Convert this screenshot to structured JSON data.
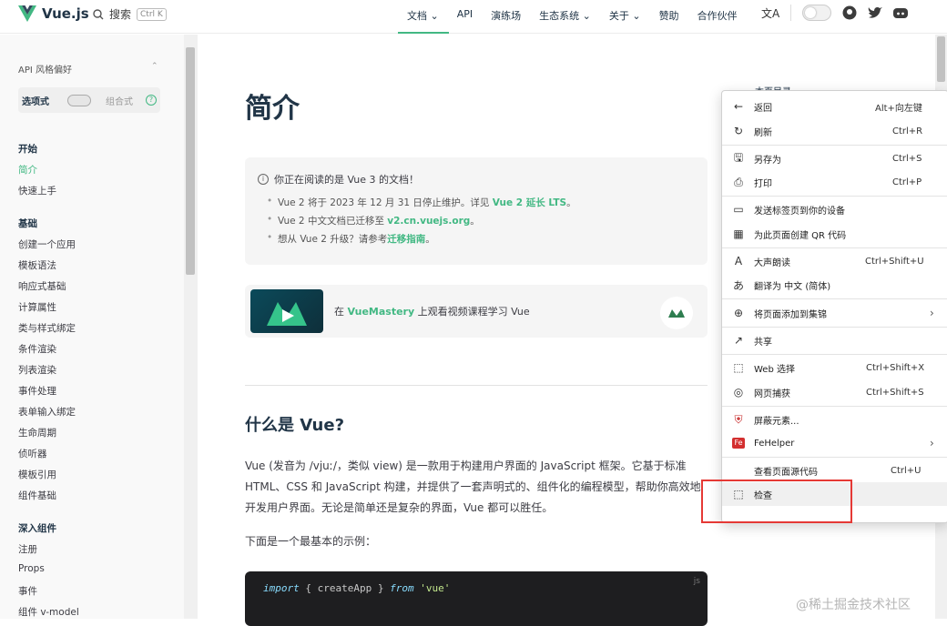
{
  "nav": {
    "logo_text": "Vue.js",
    "search_label": "搜索",
    "search_kbd": "Ctrl K",
    "links": [
      "文档 ⌄",
      "API",
      "演练场",
      "生态系统 ⌄",
      "关于 ⌄",
      "赞助",
      "合作伙伴"
    ]
  },
  "sidebar": {
    "pref_title": "API 风格偏好",
    "pref_option": "选项式",
    "pref_alt": "组合式",
    "pref_help": "?",
    "groups": [
      {
        "title": "开始",
        "items": [
          "简介",
          "快速上手"
        ]
      },
      {
        "title": "基础",
        "items": [
          "创建一个应用",
          "模板语法",
          "响应式基础",
          "计算属性",
          "类与样式绑定",
          "条件渲染",
          "列表渲染",
          "事件处理",
          "表单输入绑定",
          "生命周期",
          "侦听器",
          "模板引用",
          "组件基础"
        ]
      },
      {
        "title": "深入组件",
        "items": [
          "注册",
          "Props",
          "事件",
          "组件 v-model"
        ]
      }
    ]
  },
  "main": {
    "title": "简介",
    "notice_title": "你正在阅读的是 Vue 3 的文档！",
    "notice_items": [
      {
        "text": "Vue 2 将于 2023 年 12 月 31 日停止维护。详见 ",
        "link": "Vue 2 延长 LTS",
        "tail": "。"
      },
      {
        "text": "Vue 2 中文文档已迁移至 ",
        "link": "v2.cn.vuejs.org",
        "tail": "。"
      },
      {
        "text": "想从 Vue 2 升级？请参考",
        "link": "迁移指南",
        "tail": "。"
      }
    ],
    "mastery_pre": "在 ",
    "mastery_link": "VueMastery",
    "mastery_post": " 上观看视频课程学习 Vue",
    "h2": "什么是 Vue?",
    "para": "Vue (发音为 /vjuː/，类似 view) 是一款用于构建用户界面的 JavaScript 框架。它基于标准 HTML、CSS 和 JavaScript 构建，并提供了一套声明式的、组件化的编程模型，帮助你高效地开发用户界面。无论是简单还是复杂的界面，Vue 都可以胜任。",
    "para2": "下面是一个最基本的示例：",
    "code_lang": "js",
    "code_kw1": "import",
    "code_mid": " { createApp } ",
    "code_kw2": "from",
    "code_str": " 'vue'",
    "toc_title": "本页目录"
  },
  "context_menu": {
    "items": [
      {
        "icon": "back-icon",
        "glyph": "←",
        "label": "返回",
        "shortcut": "Alt+向左键"
      },
      {
        "icon": "refresh-icon",
        "glyph": "↻",
        "label": "刷新",
        "shortcut": "Ctrl+R"
      },
      {
        "icon": "save-as-icon",
        "glyph": "🖫",
        "label": "另存为",
        "shortcut": "Ctrl+S"
      },
      {
        "icon": "print-icon",
        "glyph": "⎙",
        "label": "打印",
        "shortcut": "Ctrl+P"
      },
      {
        "icon": "send-device-icon",
        "glyph": "▭",
        "label": "发送标签页到你的设备",
        "shortcut": ""
      },
      {
        "icon": "qr-code-icon",
        "glyph": "▦",
        "label": "为此页面创建 QR 代码",
        "shortcut": ""
      },
      {
        "icon": "read-aloud-icon",
        "glyph": "A",
        "label": "大声朗读",
        "shortcut": "Ctrl+Shift+U"
      },
      {
        "icon": "translate-icon",
        "glyph": "あ",
        "label": "翻译为 中文 (简体)",
        "shortcut": ""
      },
      {
        "icon": "collections-icon",
        "glyph": "⊕",
        "label": "将页面添加到集锦",
        "shortcut": ""
      },
      {
        "icon": "share-icon",
        "glyph": "↗",
        "label": "共享",
        "shortcut": ""
      },
      {
        "icon": "web-select-icon",
        "glyph": "⬚",
        "label": "Web 选择",
        "shortcut": "Ctrl+Shift+X"
      },
      {
        "icon": "web-capture-icon",
        "glyph": "◎",
        "label": "网页捕获",
        "shortcut": "Ctrl+Shift+S"
      },
      {
        "icon": "block-element-icon",
        "glyph": "⛨",
        "label": "屏蔽元素...",
        "shortcut": ""
      },
      {
        "icon": "fehelper-icon",
        "glyph": "Fe",
        "label": "FeHelper",
        "shortcut": ""
      },
      {
        "icon": "",
        "glyph": "",
        "label": "查看页面源代码",
        "shortcut": "Ctrl+U"
      },
      {
        "icon": "inspect-icon",
        "glyph": "⬚",
        "label": "检查",
        "shortcut": ""
      }
    ]
  },
  "watermark": "@稀土掘金技术社区",
  "colors": {
    "accent": "#42b883",
    "highlight_box": "#e53935"
  }
}
